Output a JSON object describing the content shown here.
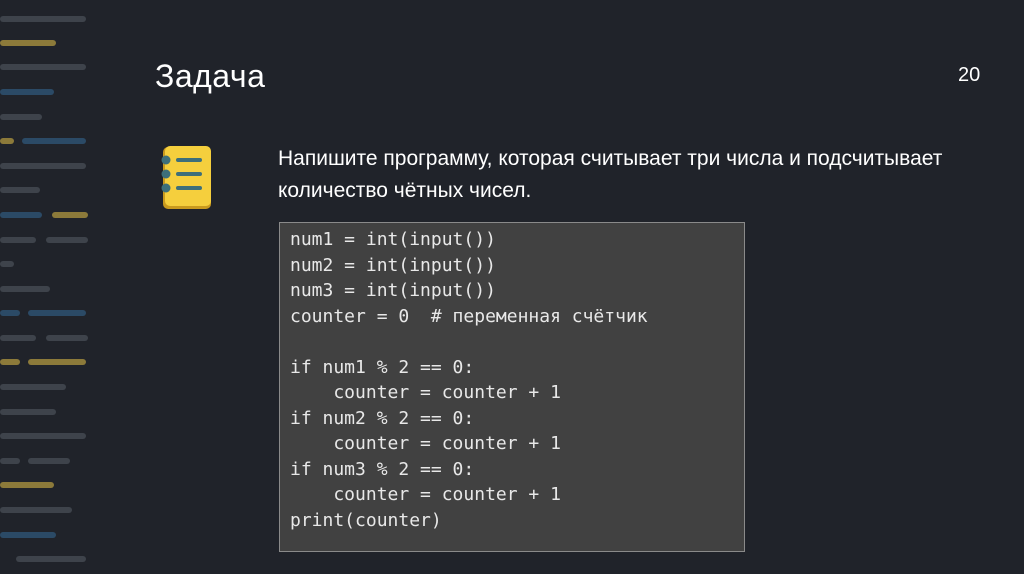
{
  "slide": {
    "title": "Задача",
    "page_number": "20",
    "task_text": "Напишите программу, которая считывает три числа и подсчитывает количество чётных чисел.",
    "task_icon": "checklist-icon",
    "code_lines": [
      "num1 = int(input())",
      "num2 = int(input())",
      "num3 = int(input())",
      "counter = 0  # переменная счётчик",
      "",
      "if num1 % 2 == 0:",
      "    counter = counter + 1",
      "if num2 % 2 == 0:",
      "    counter = counter + 1",
      "if num3 % 2 == 0:",
      "    counter = counter + 1",
      "print(counter)"
    ]
  },
  "colors": {
    "background": "#20232a",
    "code_background": "#414141",
    "code_border": "#8a8a8a",
    "icon_yellow": "#f5cf3d",
    "icon_teal": "#3d6f7a",
    "deco_gray": "#3e434b",
    "deco_blue": "#2b4a66",
    "deco_gold": "#8c7a3a"
  }
}
